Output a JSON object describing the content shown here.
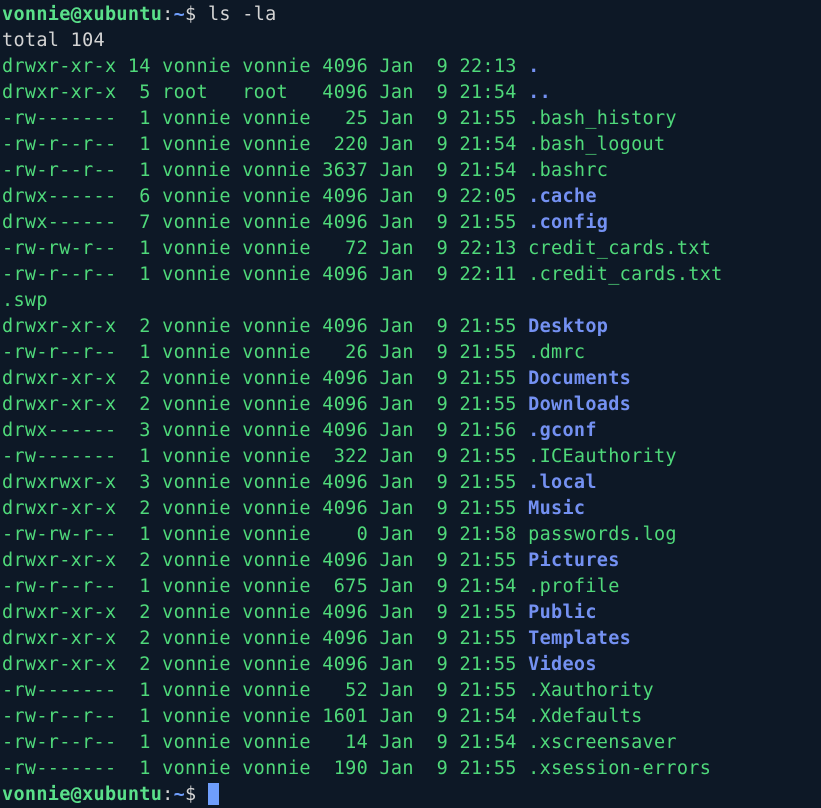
{
  "prompt": {
    "user": "vonnie",
    "host": "xubuntu",
    "path": "~",
    "symbol": "$"
  },
  "command": "ls -la",
  "total_line": "total 104",
  "entries": [
    {
      "perms": "drwxr-xr-x",
      "links": "14",
      "owner": "vonnie",
      "group": "vonnie",
      "size": "4096",
      "month": "Jan",
      "day": "9",
      "time": "22:13",
      "name": ".",
      "style": "blue-dot"
    },
    {
      "perms": "drwxr-xr-x",
      "links": "5",
      "owner": "root",
      "group": "root",
      "size": "4096",
      "month": "Jan",
      "day": "9",
      "time": "21:54",
      "name": "..",
      "style": "blue-dot"
    },
    {
      "perms": "-rw-------",
      "links": "1",
      "owner": "vonnie",
      "group": "vonnie",
      "size": "25",
      "month": "Jan",
      "day": "9",
      "time": "21:55",
      "name": ".bash_history",
      "style": "green"
    },
    {
      "perms": "-rw-r--r--",
      "links": "1",
      "owner": "vonnie",
      "group": "vonnie",
      "size": "220",
      "month": "Jan",
      "day": "9",
      "time": "21:54",
      "name": ".bash_logout",
      "style": "green"
    },
    {
      "perms": "-rw-r--r--",
      "links": "1",
      "owner": "vonnie",
      "group": "vonnie",
      "size": "3637",
      "month": "Jan",
      "day": "9",
      "time": "21:54",
      "name": ".bashrc",
      "style": "green"
    },
    {
      "perms": "drwx------",
      "links": "6",
      "owner": "vonnie",
      "group": "vonnie",
      "size": "4096",
      "month": "Jan",
      "day": "9",
      "time": "22:05",
      "name": ".cache",
      "style": "blue"
    },
    {
      "perms": "drwx------",
      "links": "7",
      "owner": "vonnie",
      "group": "vonnie",
      "size": "4096",
      "month": "Jan",
      "day": "9",
      "time": "21:55",
      "name": ".config",
      "style": "blue"
    },
    {
      "perms": "-rw-rw-r--",
      "links": "1",
      "owner": "vonnie",
      "group": "vonnie",
      "size": "72",
      "month": "Jan",
      "day": "9",
      "time": "22:13",
      "name": "credit_cards.txt",
      "style": "green"
    },
    {
      "perms": "-rw-r--r--",
      "links": "1",
      "owner": "vonnie",
      "group": "vonnie",
      "size": "4096",
      "month": "Jan",
      "day": "9",
      "time": "22:11",
      "name": ".credit_cards.txt.swp",
      "style": "green",
      "wrap_after": 17
    },
    {
      "perms": "drwxr-xr-x",
      "links": "2",
      "owner": "vonnie",
      "group": "vonnie",
      "size": "4096",
      "month": "Jan",
      "day": "9",
      "time": "21:55",
      "name": "Desktop",
      "style": "blue"
    },
    {
      "perms": "-rw-r--r--",
      "links": "1",
      "owner": "vonnie",
      "group": "vonnie",
      "size": "26",
      "month": "Jan",
      "day": "9",
      "time": "21:55",
      "name": ".dmrc",
      "style": "green"
    },
    {
      "perms": "drwxr-xr-x",
      "links": "2",
      "owner": "vonnie",
      "group": "vonnie",
      "size": "4096",
      "month": "Jan",
      "day": "9",
      "time": "21:55",
      "name": "Documents",
      "style": "blue"
    },
    {
      "perms": "drwxr-xr-x",
      "links": "2",
      "owner": "vonnie",
      "group": "vonnie",
      "size": "4096",
      "month": "Jan",
      "day": "9",
      "time": "21:55",
      "name": "Downloads",
      "style": "blue"
    },
    {
      "perms": "drwx------",
      "links": "3",
      "owner": "vonnie",
      "group": "vonnie",
      "size": "4096",
      "month": "Jan",
      "day": "9",
      "time": "21:56",
      "name": ".gconf",
      "style": "blue"
    },
    {
      "perms": "-rw-------",
      "links": "1",
      "owner": "vonnie",
      "group": "vonnie",
      "size": "322",
      "month": "Jan",
      "day": "9",
      "time": "21:55",
      "name": ".ICEauthority",
      "style": "green"
    },
    {
      "perms": "drwxrwxr-x",
      "links": "3",
      "owner": "vonnie",
      "group": "vonnie",
      "size": "4096",
      "month": "Jan",
      "day": "9",
      "time": "21:55",
      "name": ".local",
      "style": "blue"
    },
    {
      "perms": "drwxr-xr-x",
      "links": "2",
      "owner": "vonnie",
      "group": "vonnie",
      "size": "4096",
      "month": "Jan",
      "day": "9",
      "time": "21:55",
      "name": "Music",
      "style": "blue"
    },
    {
      "perms": "-rw-rw-r--",
      "links": "1",
      "owner": "vonnie",
      "group": "vonnie",
      "size": "0",
      "month": "Jan",
      "day": "9",
      "time": "21:58",
      "name": "passwords.log",
      "style": "green"
    },
    {
      "perms": "drwxr-xr-x",
      "links": "2",
      "owner": "vonnie",
      "group": "vonnie",
      "size": "4096",
      "month": "Jan",
      "day": "9",
      "time": "21:55",
      "name": "Pictures",
      "style": "blue"
    },
    {
      "perms": "-rw-r--r--",
      "links": "1",
      "owner": "vonnie",
      "group": "vonnie",
      "size": "675",
      "month": "Jan",
      "day": "9",
      "time": "21:54",
      "name": ".profile",
      "style": "green"
    },
    {
      "perms": "drwxr-xr-x",
      "links": "2",
      "owner": "vonnie",
      "group": "vonnie",
      "size": "4096",
      "month": "Jan",
      "day": "9",
      "time": "21:55",
      "name": "Public",
      "style": "blue"
    },
    {
      "perms": "drwxr-xr-x",
      "links": "2",
      "owner": "vonnie",
      "group": "vonnie",
      "size": "4096",
      "month": "Jan",
      "day": "9",
      "time": "21:55",
      "name": "Templates",
      "style": "blue"
    },
    {
      "perms": "drwxr-xr-x",
      "links": "2",
      "owner": "vonnie",
      "group": "vonnie",
      "size": "4096",
      "month": "Jan",
      "day": "9",
      "time": "21:55",
      "name": "Videos",
      "style": "blue"
    },
    {
      "perms": "-rw-------",
      "links": "1",
      "owner": "vonnie",
      "group": "vonnie",
      "size": "52",
      "month": "Jan",
      "day": "9",
      "time": "21:55",
      "name": ".Xauthority",
      "style": "green"
    },
    {
      "perms": "-rw-r--r--",
      "links": "1",
      "owner": "vonnie",
      "group": "vonnie",
      "size": "1601",
      "month": "Jan",
      "day": "9",
      "time": "21:54",
      "name": ".Xdefaults",
      "style": "green"
    },
    {
      "perms": "-rw-r--r--",
      "links": "1",
      "owner": "vonnie",
      "group": "vonnie",
      "size": "14",
      "month": "Jan",
      "day": "9",
      "time": "21:54",
      "name": ".xscreensaver",
      "style": "green"
    },
    {
      "perms": "-rw-------",
      "links": "1",
      "owner": "vonnie",
      "group": "vonnie",
      "size": "190",
      "month": "Jan",
      "day": "9",
      "time": "21:55",
      "name": ".xsession-errors",
      "style": "green"
    }
  ]
}
